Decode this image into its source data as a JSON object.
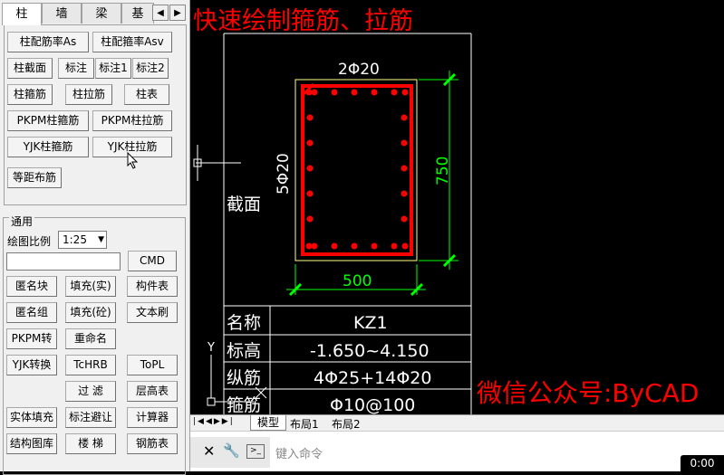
{
  "tabs": [
    "柱",
    "墙",
    "梁",
    "基"
  ],
  "nav": {
    "left": "◀",
    "right": "▶"
  },
  "buttons": {
    "asb": "柱配筋率As",
    "asv": "柱配箍率Asv",
    "jiemian": "柱截面",
    "biaozhu": "标注",
    "biaozhu1": "标注1",
    "biaozhu2": "标注2",
    "gujin": "柱箍筋",
    "lajin": "柱拉筋",
    "biao": "柱表",
    "pkpm_gu": "PKPM柱箍筋",
    "pkpm_la": "PKPM柱拉筋",
    "yjk_gu": "YJK柱箍筋",
    "yjk_la": "YJK柱拉筋",
    "dengju": "等距布筋"
  },
  "general": {
    "title": "通用",
    "scale_label": "绘图比例",
    "scale_value": "1:25",
    "cmd": "CMD",
    "rows": [
      [
        "匿名块",
        "填充(实)",
        "构件表"
      ],
      [
        "匿名组",
        "填充(砼)",
        "文本刷"
      ],
      [
        "PKPM转",
        "重命名",
        ""
      ],
      [
        "YJK转换",
        "TcHRB",
        "ToPL"
      ],
      [
        "",
        "过  滤",
        "层高表"
      ],
      [
        "实体填充",
        "标注避让",
        "计算器"
      ],
      [
        "结构图库",
        "楼  梯",
        "钢筋表"
      ]
    ]
  },
  "drawing": {
    "title": "快速绘制箍筋、拉筋",
    "top_bars": "2Φ20",
    "side_bars": "5Φ20",
    "dim_h": "750",
    "dim_w": "500",
    "section_label": "截面",
    "table": [
      [
        "名称",
        "KZ1"
      ],
      [
        "标高",
        "-1.650~4.150"
      ],
      [
        "纵筋",
        "4Φ25+14Φ20"
      ],
      [
        "箍筋",
        "Φ10@100"
      ]
    ],
    "watermark": "微信公众号:ByCAD",
    "ucs_y": "Y",
    "colors": {
      "title": "#ff0000",
      "rebar": "#ff0000",
      "dim": "#00ff00",
      "outline": "#ffff80",
      "lines": "#ffffff"
    }
  },
  "layout_tabs": [
    "模型",
    "布局1",
    "布局2"
  ],
  "command": {
    "placeholder": "键入命令",
    "time": "0:00"
  }
}
